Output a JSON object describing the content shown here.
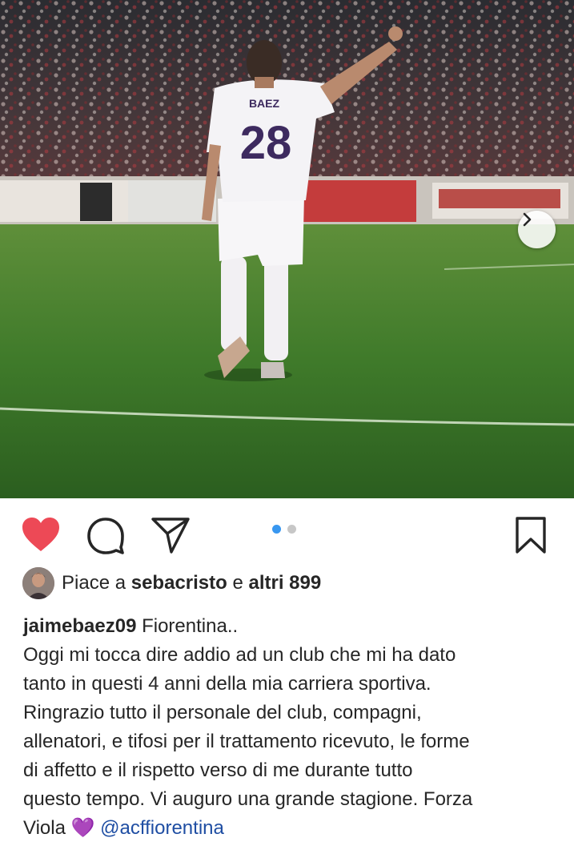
{
  "photo": {
    "jersey_name": "BAEZ",
    "jersey_number": "28"
  },
  "actions": {
    "like_icon": "heart-filled-icon",
    "comment_icon": "comment-icon",
    "share_icon": "paper-plane-icon",
    "save_icon": "bookmark-icon",
    "next_icon": "chevron-right-icon",
    "carousel": {
      "total": 2,
      "current": 1
    },
    "colors": {
      "heart": "#ed4956",
      "dot_active": "#3897f0",
      "dot_inactive": "#c7c7c7",
      "link": "#1f4ea3"
    }
  },
  "likes": {
    "prefix": "Piace a",
    "user": "sebacristo",
    "middle": "e",
    "others": "altri 899"
  },
  "caption": {
    "username": "jaimebaez09",
    "first_line_text": "Fiorentina..",
    "lines": [
      "Oggi mi tocca dire addio ad un club che mi ha dato",
      "tanto in questi 4 anni della mia carriera sportiva.",
      "Ringrazio tutto il personale del club, compagni,",
      "allenatori, e tifosi per il trattamento ricevuto, le forme",
      "di affetto e il rispetto verso di me durante tutto",
      "questo tempo. Vi auguro una grande stagione. Forza"
    ],
    "last_line_text": "Viola",
    "emoji": "💜",
    "mention": "@acffiorentina"
  }
}
